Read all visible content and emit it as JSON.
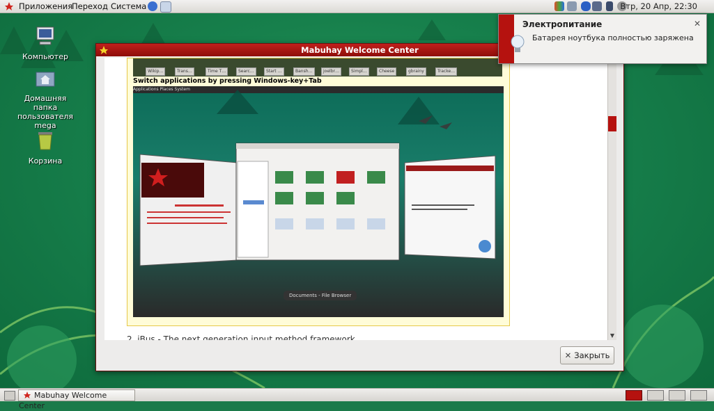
{
  "top_panel": {
    "menu_apps": "Приложения",
    "menu_places": "Переход",
    "menu_system": "Система",
    "clock": "Втр, 20 Апр, 22:30"
  },
  "desktop": {
    "icons": [
      {
        "label": "Компьютер"
      },
      {
        "label": "Домашняя папка пользователя mega"
      },
      {
        "label": "Корзина"
      }
    ]
  },
  "window": {
    "title": "Mabuhay Welcome Center",
    "caption": "Switch applications by pressing Windows-key+Tab",
    "tooltip": "Documents - File Browser",
    "next_item": "2. iBus - The next generation input method framework",
    "close_label": "Закрыть"
  },
  "notification": {
    "title": "Электропитание",
    "body": "Батарея ноутбука полностью заряжена"
  },
  "bottom_panel": {
    "task_label": "Mabuhay Welcome Center"
  },
  "colors": {
    "accent_red": "#b5120f",
    "wallpaper_green": "#1b7a4a"
  }
}
